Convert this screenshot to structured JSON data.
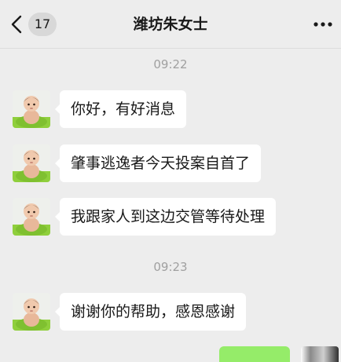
{
  "header": {
    "unread_count": "17",
    "title": "潍坊朱女士",
    "back_icon": "chevron-left-icon",
    "more_icon": "more-horizontal-icon"
  },
  "chat": {
    "timestamps": [
      "09:22",
      "09:23"
    ],
    "messages": [
      {
        "sender": "contact",
        "text": "你好，有好消息"
      },
      {
        "sender": "contact",
        "text": "肇事逃逸者今天投案自首了"
      },
      {
        "sender": "contact",
        "text": "我跟家人到这边交管等待处理"
      },
      {
        "sender": "contact",
        "text": "谢谢你的帮助，感恩感谢"
      }
    ]
  },
  "colors": {
    "background": "#ededed",
    "incoming_bubble": "#ffffff",
    "outgoing_bubble": "#95ec69",
    "timestamp_text": "#a0a0a0"
  }
}
